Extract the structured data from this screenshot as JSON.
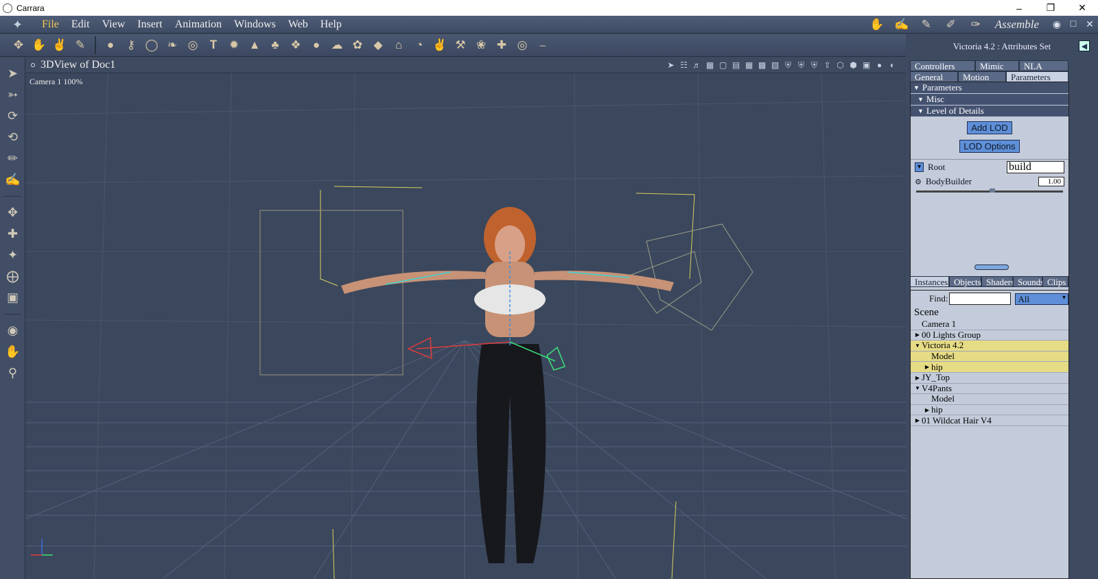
{
  "window": {
    "title": "Carrara"
  },
  "menu": {
    "items": [
      "File",
      "Edit",
      "View",
      "Insert",
      "Animation",
      "Windows",
      "Web",
      "Help"
    ],
    "room_label": "Assemble"
  },
  "viewport": {
    "title": "3DView of Doc1",
    "camera_label": "Camera 1 100%"
  },
  "attributes": {
    "title": "Victoria 4.2 : Attributes Set",
    "tabs_row1": [
      "Controllers",
      "Mimic",
      "NLA"
    ],
    "tabs_row2": [
      "General",
      "Motion",
      "Parameters"
    ],
    "sections": {
      "parameters": "Parameters",
      "misc": "Misc",
      "lod": "Level of Details"
    },
    "buttons": {
      "add_lod": "Add LOD",
      "lod_options": "LOD Options"
    },
    "root_label": "Root",
    "root_value": "build",
    "bodybuilder_label": "BodyBuilder",
    "bodybuilder_value": "1.00"
  },
  "instances": {
    "tabs": [
      "Instances",
      "Objects",
      "Shaders",
      "Sounds",
      "Clips"
    ],
    "find_label": "Find:",
    "find_value": "",
    "filter": "All",
    "scene_title": "Scene",
    "tree": [
      {
        "label": "Camera 1",
        "indent": 0,
        "expander": "",
        "highlight": false
      },
      {
        "label": "00 Lights Group",
        "indent": 0,
        "expander": "▶",
        "highlight": false
      },
      {
        "label": "Victoria 4.2",
        "indent": 0,
        "expander": "▼",
        "highlight": true
      },
      {
        "label": "Model",
        "indent": 1,
        "expander": "",
        "highlight": true
      },
      {
        "label": "hip",
        "indent": 1,
        "expander": "▶",
        "highlight": true
      },
      {
        "label": "JY_Top",
        "indent": 0,
        "expander": "▶",
        "highlight": false
      },
      {
        "label": "V4Pants",
        "indent": 0,
        "expander": "▼",
        "highlight": false
      },
      {
        "label": "Model",
        "indent": 1,
        "expander": "",
        "highlight": false
      },
      {
        "label": "hip",
        "indent": 1,
        "expander": "▶",
        "highlight": false
      },
      {
        "label": "01 Wildcat Hair V4",
        "indent": 0,
        "expander": "▶",
        "highlight": false
      }
    ]
  }
}
